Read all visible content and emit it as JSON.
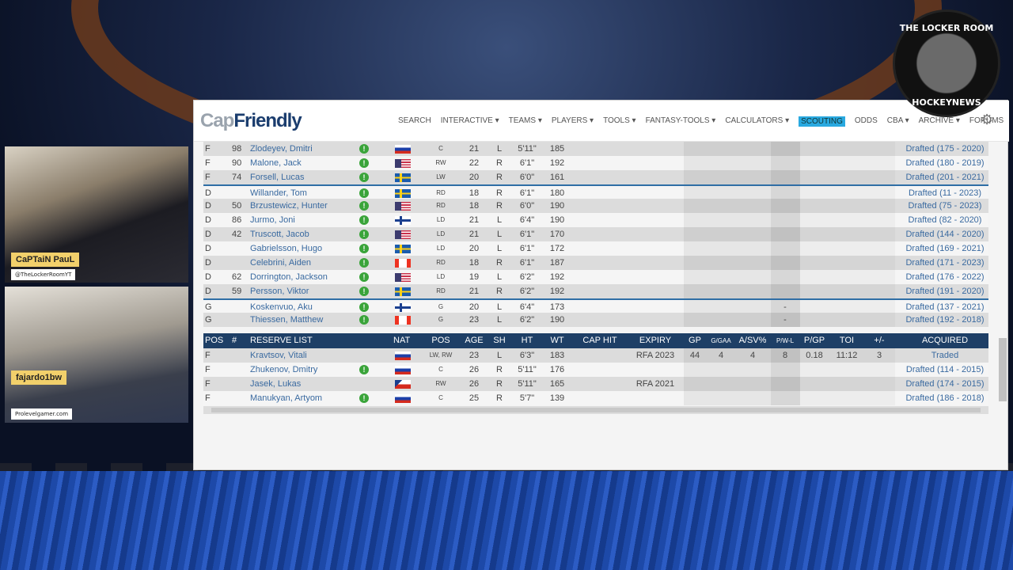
{
  "overlay": {
    "logo_text": [
      "THE LOCKER ROOM",
      "HOCKEYNEWS"
    ],
    "cams": [
      {
        "name": "CaPTaiN PauL",
        "handle": "@TheLockerRoomYT"
      },
      {
        "name": "fajardo1bw",
        "handle": "Prolevelgamer.com"
      }
    ]
  },
  "site": {
    "brand_cap": "Cap",
    "brand_friendly": "Friendly",
    "nav": [
      "SEARCH",
      "INTERACTIVE ▾",
      "TEAMS ▾",
      "PLAYERS ▾",
      "TOOLS ▾",
      "FANTASY-TOOLS ▾",
      "CALCULATORS ▾",
      "SCOUTING",
      "ODDS",
      "CBA ▾",
      "ARCHIVE ▾",
      "FORUMS"
    ],
    "nav_active": "SCOUTING",
    "accent": "#29a9e0",
    "header_color": "#1e3f66"
  },
  "roster": [
    {
      "pos": "F",
      "num": "98",
      "name": "Zlodeyev, Dmitri",
      "nat": "ru",
      "ppos": "C",
      "age": "21",
      "sh": "L",
      "ht": "5'11\"",
      "wt": "185",
      "acq": "Drafted (175 - 2020)"
    },
    {
      "pos": "F",
      "num": "90",
      "name": "Malone, Jack",
      "nat": "us",
      "ppos": "RW",
      "age": "22",
      "sh": "R",
      "ht": "6'1\"",
      "wt": "192",
      "acq": "Drafted (180 - 2019)"
    },
    {
      "pos": "F",
      "num": "74",
      "name": "Forsell, Lucas",
      "nat": "se",
      "ppos": "LW",
      "age": "20",
      "sh": "R",
      "ht": "6'0\"",
      "wt": "161",
      "acq": "Drafted (201 - 2021)"
    },
    {
      "pos": "D",
      "num": "",
      "name": "Willander, Tom",
      "nat": "se",
      "ppos": "RD",
      "age": "18",
      "sh": "R",
      "ht": "6'1\"",
      "wt": "180",
      "acq": "Drafted (11 - 2023)",
      "sep": true
    },
    {
      "pos": "D",
      "num": "50",
      "name": "Brzustewicz, Hunter",
      "nat": "us",
      "ppos": "RD",
      "age": "18",
      "sh": "R",
      "ht": "6'0\"",
      "wt": "190",
      "acq": "Drafted (75 - 2023)"
    },
    {
      "pos": "D",
      "num": "86",
      "name": "Jurmo, Joni",
      "nat": "fi",
      "ppos": "LD",
      "age": "21",
      "sh": "L",
      "ht": "6'4\"",
      "wt": "190",
      "acq": "Drafted (82 - 2020)"
    },
    {
      "pos": "D",
      "num": "42",
      "name": "Truscott, Jacob",
      "nat": "us",
      "ppos": "LD",
      "age": "21",
      "sh": "L",
      "ht": "6'1\"",
      "wt": "170",
      "acq": "Drafted (144 - 2020)"
    },
    {
      "pos": "D",
      "num": "",
      "name": "Gabrielsson, Hugo",
      "nat": "se",
      "ppos": "LD",
      "age": "20",
      "sh": "L",
      "ht": "6'1\"",
      "wt": "172",
      "acq": "Drafted (169 - 2021)"
    },
    {
      "pos": "D",
      "num": "",
      "name": "Celebrini, Aiden",
      "nat": "ca",
      "ppos": "RD",
      "age": "18",
      "sh": "R",
      "ht": "6'1\"",
      "wt": "187",
      "acq": "Drafted (171 - 2023)"
    },
    {
      "pos": "D",
      "num": "62",
      "name": "Dorrington, Jackson",
      "nat": "us",
      "ppos": "LD",
      "age": "19",
      "sh": "L",
      "ht": "6'2\"",
      "wt": "192",
      "acq": "Drafted (176 - 2022)"
    },
    {
      "pos": "D",
      "num": "59",
      "name": "Persson, Viktor",
      "nat": "se",
      "ppos": "RD",
      "age": "21",
      "sh": "R",
      "ht": "6'2\"",
      "wt": "192",
      "acq": "Drafted (191 - 2020)"
    },
    {
      "pos": "G",
      "num": "",
      "name": "Koskenvuo, Aku",
      "nat": "fi",
      "ppos": "G",
      "age": "20",
      "sh": "L",
      "ht": "6'4\"",
      "wt": "173",
      "pwl": "-",
      "acq": "Drafted (137 - 2021)",
      "sep": true
    },
    {
      "pos": "G",
      "num": "",
      "name": "Thiessen, Matthew",
      "nat": "ca",
      "ppos": "G",
      "age": "23",
      "sh": "L",
      "ht": "6'2\"",
      "wt": "190",
      "pwl": "-",
      "acq": "Drafted (192 - 2018)"
    }
  ],
  "reserve_headers": {
    "pos": "POS",
    "num": "#",
    "name": "RESERVE LIST",
    "nat": "NAT",
    "ppos": "POS",
    "age": "AGE",
    "sh": "SH",
    "ht": "HT",
    "wt": "WT",
    "cap": "CAP HIT",
    "exp": "EXPIRY",
    "gp": "GP",
    "g": "G/GAA",
    "a": "A/SV%",
    "pwl": "P/W-L",
    "pgp": "P/GP",
    "toi": "TOI",
    "pm": "+/-",
    "acq": "ACQUIRED"
  },
  "reserve": [
    {
      "pos": "F",
      "name": "Kravtsov, Vitali",
      "nat": "ru",
      "ppos": "LW, RW",
      "age": "23",
      "sh": "L",
      "ht": "6'3\"",
      "wt": "183",
      "exp": "RFA 2023",
      "gp": "44",
      "g": "4",
      "a": "4",
      "pwl": "8",
      "pgp": "0.18",
      "toi": "11:12",
      "pm": "3",
      "acq": "Traded",
      "noicon": true
    },
    {
      "pos": "F",
      "name": "Zhukenov, Dmitry",
      "nat": "ru",
      "ppos": "C",
      "age": "26",
      "sh": "R",
      "ht": "5'11\"",
      "wt": "176",
      "acq": "Drafted (114 - 2015)"
    },
    {
      "pos": "F",
      "name": "Jasek, Lukas",
      "nat": "cz",
      "ppos": "RW",
      "age": "26",
      "sh": "R",
      "ht": "5'11\"",
      "wt": "165",
      "exp": "RFA 2021",
      "acq": "Drafted (174 - 2015)",
      "noicon": true
    },
    {
      "pos": "F",
      "name": "Manukyan, Artyom",
      "nat": "ru",
      "ppos": "C",
      "age": "25",
      "sh": "R",
      "ht": "5'7\"",
      "wt": "139",
      "acq": "Drafted (186 - 2018)"
    }
  ]
}
